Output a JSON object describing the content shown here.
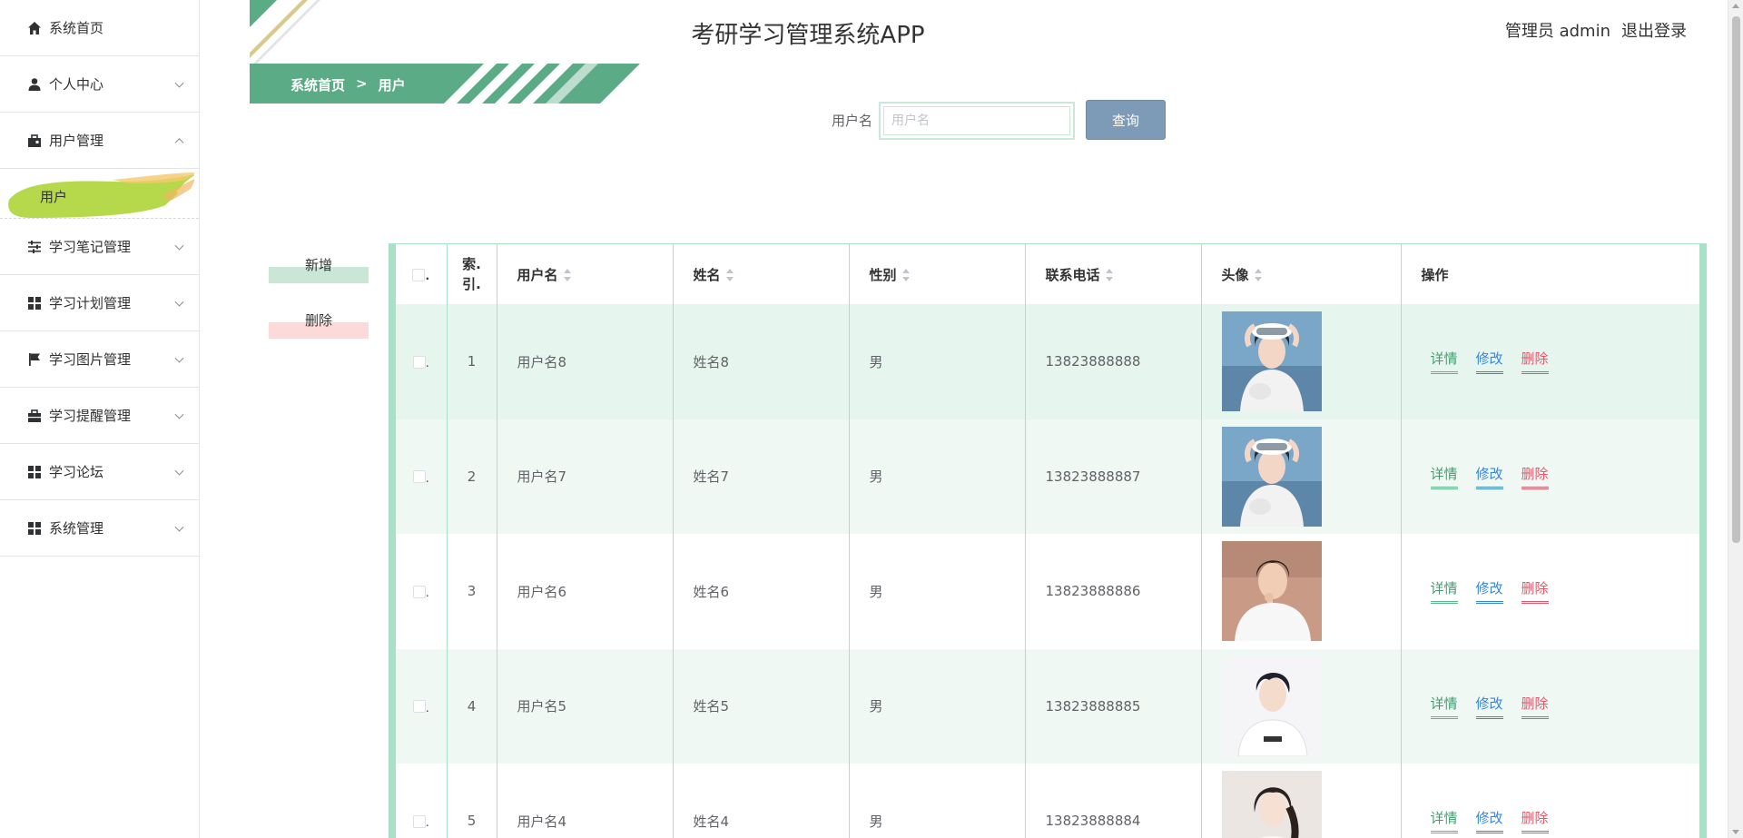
{
  "app": {
    "title": "考研学习管理系统APP"
  },
  "header": {
    "admin_label": "管理员 admin",
    "logout_label": "退出登录"
  },
  "breadcrumb": {
    "home": "系统首页",
    "separator": ">",
    "current": "用户"
  },
  "sidebar": {
    "items": [
      {
        "label": "系统首页",
        "icon": "home-icon"
      },
      {
        "label": "个人中心",
        "icon": "person-icon"
      },
      {
        "label": "用户管理",
        "icon": "briefcase-icon"
      },
      {
        "label": "学习笔记管理",
        "icon": "sliders-icon"
      },
      {
        "label": "学习计划管理",
        "icon": "grid-icon"
      },
      {
        "label": "学习图片管理",
        "icon": "flag-icon"
      },
      {
        "label": "学习提醒管理",
        "icon": "toolbox-icon"
      },
      {
        "label": "学习论坛",
        "icon": "grid-icon"
      },
      {
        "label": "系统管理",
        "icon": "grid-icon"
      }
    ],
    "sub_active": "用户"
  },
  "search": {
    "label": "用户名",
    "placeholder": "用户名",
    "value": "",
    "button": "查询"
  },
  "actions": {
    "add": "新增",
    "delete": "删除"
  },
  "table": {
    "columns": {
      "select": ".",
      "index_line1": "索.",
      "index_line2": "引.",
      "username": "用户名",
      "name": "姓名",
      "gender": "性别",
      "phone": "联系电话",
      "avatar": "头像",
      "ops": "操作"
    },
    "rows": [
      {
        "index": "1",
        "username": "用户名8",
        "name": "姓名8",
        "gender": "男",
        "phone": "13823888888",
        "avatar": "goggles-girl"
      },
      {
        "index": "2",
        "username": "用户名7",
        "name": "姓名7",
        "gender": "男",
        "phone": "13823888887",
        "avatar": "goggles-girl"
      },
      {
        "index": "3",
        "username": "用户名6",
        "name": "姓名6",
        "gender": "男",
        "phone": "13823888886",
        "avatar": "boy-white-shirt"
      },
      {
        "index": "4",
        "username": "用户名5",
        "name": "姓名5",
        "gender": "男",
        "phone": "13823888885",
        "avatar": "boy-portrait"
      },
      {
        "index": "5",
        "username": "用户名4",
        "name": "姓名4",
        "gender": "男",
        "phone": "13823888884",
        "avatar": "girl-portrait"
      }
    ],
    "ops": {
      "view": "详情",
      "edit": "修改",
      "delete": "删除"
    }
  },
  "colors": {
    "accent_green": "#5aab86",
    "active_menu": "#b5d94a",
    "search_button": "#7d9ab6",
    "table_border": "#a8e0c8",
    "delete_red": "#e05a6b",
    "edit_blue": "#3a86d6"
  }
}
